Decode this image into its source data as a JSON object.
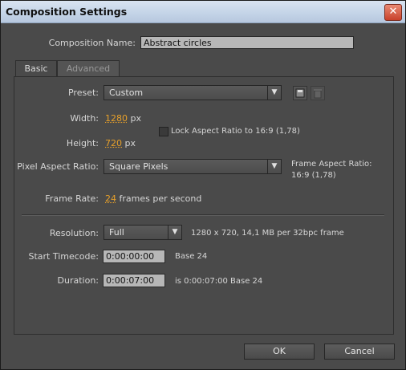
{
  "window": {
    "title": "Composition Settings",
    "close_glyph": "✕"
  },
  "composition_name": {
    "label": "Composition Name:",
    "value": "Abstract circles"
  },
  "tabs": [
    {
      "label": "Basic",
      "active": true
    },
    {
      "label": "Advanced",
      "active": false
    }
  ],
  "preset": {
    "label": "Preset:",
    "value": "Custom",
    "save_icon": "save-preset-icon",
    "delete_icon": "delete-preset-icon"
  },
  "width": {
    "label": "Width:",
    "value": "1280",
    "unit": "px"
  },
  "height": {
    "label": "Height:",
    "value": "720",
    "unit": "px"
  },
  "lock_aspect": {
    "label": "Lock Aspect Ratio to 16:9 (1,78)",
    "checked": false
  },
  "pixel_aspect": {
    "label": "Pixel Aspect Ratio:",
    "value": "Square Pixels",
    "frame_aspect_label": "Frame Aspect Ratio:",
    "frame_aspect_value": "16:9 (1,78)"
  },
  "frame_rate": {
    "label": "Frame Rate:",
    "value": "24",
    "unit": "frames per second"
  },
  "resolution": {
    "label": "Resolution:",
    "value": "Full",
    "info": "1280 x 720, 14,1 MB per 32bpc frame"
  },
  "start_timecode": {
    "label": "Start Timecode:",
    "value": "0:00:00:00",
    "info": "Base 24"
  },
  "duration": {
    "label": "Duration:",
    "value": "0:00:07:00",
    "info": "is 0:00:07:00  Base 24"
  },
  "buttons": {
    "ok": "OK",
    "cancel": "Cancel"
  },
  "colors": {
    "accent_value": "#e7a02a",
    "dialog_bg": "#4a4a4a"
  }
}
